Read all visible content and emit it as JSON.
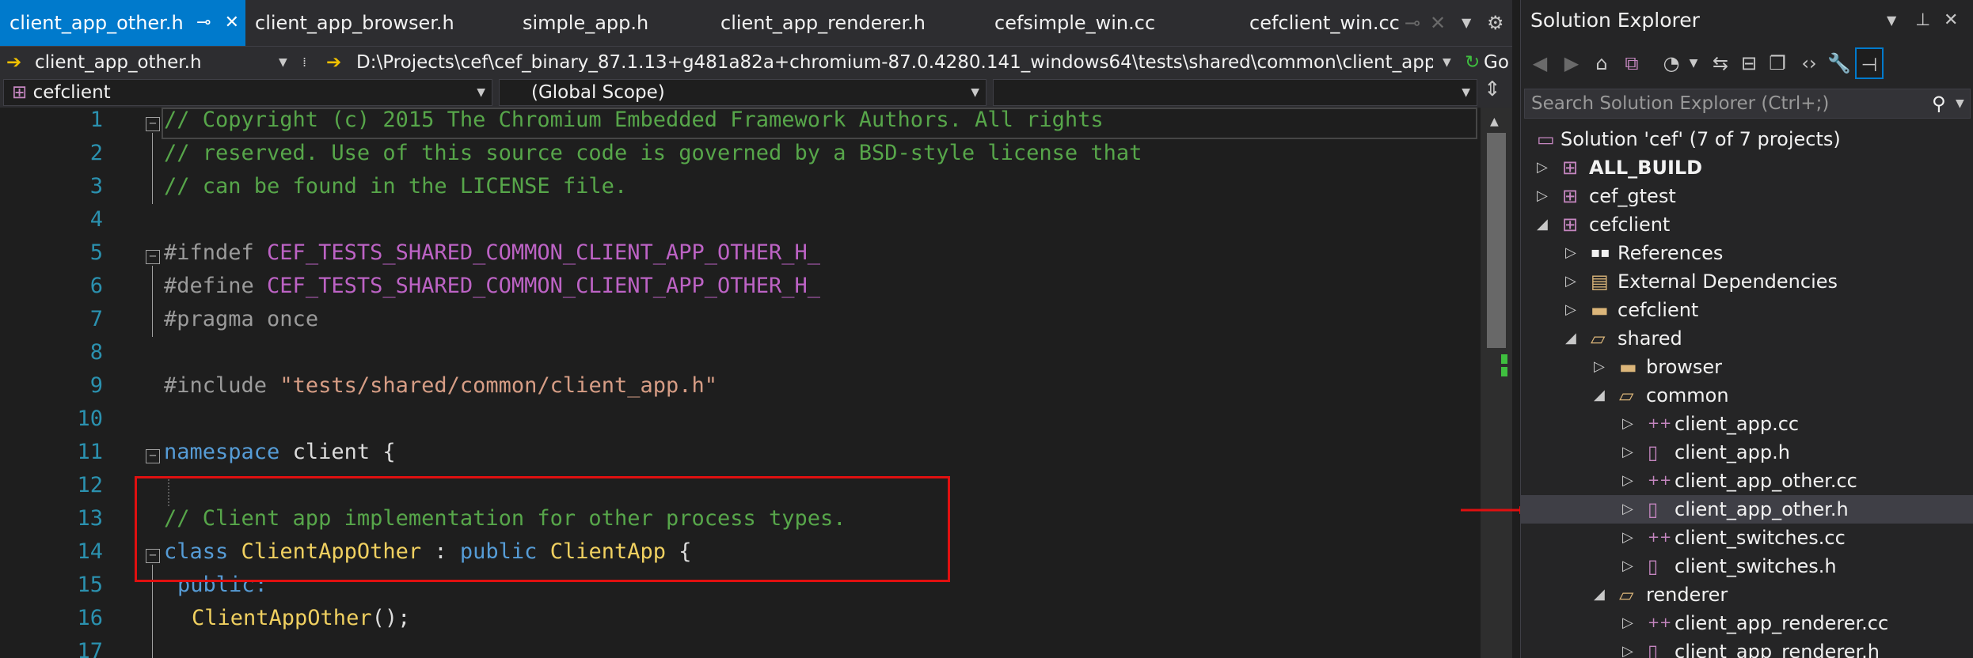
{
  "tabs": [
    {
      "label": "client_app_other.h",
      "active": true
    },
    {
      "label": "client_app_browser.h"
    },
    {
      "label": "simple_app.h"
    },
    {
      "label": "client_app_renderer.h"
    },
    {
      "label": "cefsimple_win.cc"
    },
    {
      "label": "cefclient_win.cc"
    }
  ],
  "pathbar": {
    "file": "client_app_other.h",
    "path": "D:\\Projects\\cef\\cef_binary_87.1.13+g481a82a+chromium-87.0.4280.141_windows64\\tests\\shared\\common\\client_app_",
    "go": "Go"
  },
  "navbar": {
    "project": "cefclient",
    "scope": "(Global Scope)",
    "member": ""
  },
  "code": {
    "line_numbers": [
      "1",
      "2",
      "3",
      "4",
      "5",
      "6",
      "7",
      "8",
      "9",
      "10",
      "11",
      "12",
      "13",
      "14",
      "15",
      "16",
      "17"
    ],
    "l1": "// Copyright (c) 2015 The Chromium Embedded Framework Authors. All rights",
    "l2": "// reserved. Use of this source code is governed by a BSD-style license that",
    "l3": "// can be found in the LICENSE file.",
    "l5_kw": "#ifndef ",
    "l5_mac": "CEF_TESTS_SHARED_COMMON_CLIENT_APP_OTHER_H_",
    "l6_kw": "#define ",
    "l6_mac": "CEF_TESTS_SHARED_COMMON_CLIENT_APP_OTHER_H_",
    "l7_kw": "#pragma ",
    "l7_rest": "once",
    "l9_kw": "#include ",
    "l9_str": "\"tests/shared/common/client_app.h\"",
    "l11_kw": "namespace ",
    "l11_rest": "client {",
    "l13": "// Client app implementation for other process types.",
    "l14_kw": "class ",
    "l14_type": "ClientAppOther",
    "l14_mid": " : ",
    "l14_kw2": "public ",
    "l14_type2": "ClientApp",
    "l14_end": " {",
    "l15": "public:",
    "l16_type": "ClientAppOther",
    "l16_end": "();"
  },
  "solution_explorer": {
    "title": "Solution Explorer",
    "search_placeholder": "Search Solution Explorer (Ctrl+;)",
    "tree": [
      {
        "label": "Solution 'cef' (7 of 7 projects)",
        "icon": "solution-icon"
      },
      {
        "label": "ALL_BUILD",
        "icon": "project-icon",
        "bold": true
      },
      {
        "label": "cef_gtest",
        "icon": "project-icon"
      },
      {
        "label": "cefclient",
        "icon": "project-icon"
      },
      {
        "label": "References",
        "icon": "references-icon"
      },
      {
        "label": "External Dependencies",
        "icon": "external-deps-icon"
      },
      {
        "label": "cefclient",
        "icon": "folder-icon"
      },
      {
        "label": "shared",
        "icon": "folder-open-icon"
      },
      {
        "label": "browser",
        "icon": "folder-icon"
      },
      {
        "label": "common",
        "icon": "folder-open-icon"
      },
      {
        "label": "client_app.cc",
        "icon": "cpp-file-icon"
      },
      {
        "label": "client_app.h",
        "icon": "header-file-icon"
      },
      {
        "label": "client_app_other.cc",
        "icon": "cpp-file-icon"
      },
      {
        "label": "client_app_other.h",
        "icon": "header-file-icon",
        "selected": true
      },
      {
        "label": "client_switches.cc",
        "icon": "cpp-file-icon"
      },
      {
        "label": "client_switches.h",
        "icon": "header-file-icon"
      },
      {
        "label": "renderer",
        "icon": "folder-open-icon"
      },
      {
        "label": "client_app_renderer.cc",
        "icon": "cpp-file-icon"
      },
      {
        "label": "client_app_renderer.h",
        "icon": "header-file-icon"
      }
    ]
  },
  "colors": {
    "accent": "#007acc",
    "highlight_box": "#e01010",
    "arrow": "#e01010"
  }
}
